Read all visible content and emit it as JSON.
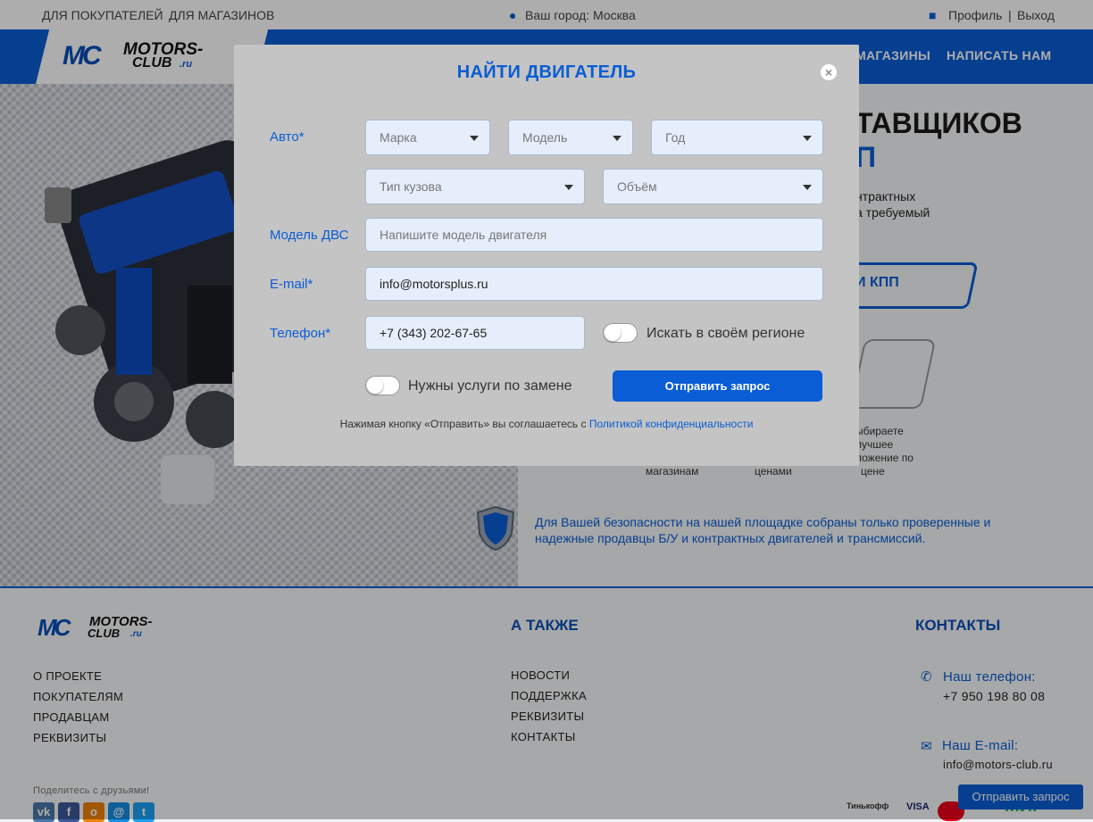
{
  "topbar": {
    "buyers": "ДЛЯ ПОКУПАТЕЛЕЙ",
    "stores": "ДЛЯ МАГАЗИНОВ",
    "city": "Ваш город: Москва",
    "profile": "Профиль",
    "separator": "|",
    "logout": "Выход"
  },
  "logo": {
    "main": "MOTORS-",
    "sub": "CLUB",
    "tld": ".ru"
  },
  "nav": {
    "stores": "МАГАЗИНЫ",
    "write": "НАПИСАТЬ НАМ"
  },
  "hero": {
    "title_line1": "ТАВЩИКОВ",
    "title_line2": "П",
    "text1": "нтрактных",
    "text2": "а требуемый",
    "button": "И КПП",
    "step3_l1": "ыбираете",
    "step3_l2": "лучшее",
    "step3_l3": "ложение по",
    "step3_l4": "цене",
    "step1_tail": "магазинам",
    "step2_tail": "ценами",
    "safety": "Для Вашей безопасности на нашей площадке собраны только проверенные и надежные продавцы Б/У и контрактных двигателей и трансмиссий."
  },
  "footer": {
    "col1": [
      "О ПРОЕКТЕ",
      "ПОКУПАТЕЛЯМ",
      "ПРОДАВЦАМ",
      "РЕКВИЗИТЫ"
    ],
    "share": "Поделитесь с друзьями!",
    "also_title": "А ТАКЖЕ",
    "col2": [
      "НОВОСТИ",
      "ПОДДЕРЖКА",
      "РЕКВИЗИТЫ",
      "КОНТАКТЫ"
    ],
    "contacts_title": "КОНТАКТЫ",
    "phone_label": "Наш телефон:",
    "phone": "+7 950 198 80 08",
    "email_label": "Наш E-mail:",
    "email": "info@motors-club.ru",
    "sticky": "Отправить запрос",
    "pay": [
      "Тинькофф",
      "VISA",
      "МИР"
    ]
  },
  "modal": {
    "title": "НАЙТИ ДВИГАТЕЛЬ",
    "close": "×",
    "label_auto": "Авто*",
    "brand": "Марка",
    "model": "Модель",
    "year": "Год",
    "body": "Тип кузова",
    "volume": "Объём",
    "label_engine": "Модель ДВС",
    "engine_placeholder": "Напишите модель двигателя",
    "label_email": "E-mail*",
    "email_value": "info@motorsplus.ru",
    "label_phone": "Телефон*",
    "phone_value": "+7 (343) 202-67-65",
    "region_toggle": "Искать в своём регионе",
    "replace_toggle": "Нужны услуги по замене",
    "submit": "Отправить запрос",
    "consent_text": "Нажимая кнопку «Отправить» вы соглашаетесь с",
    "consent_link": "Политикой конфиденциальности"
  }
}
